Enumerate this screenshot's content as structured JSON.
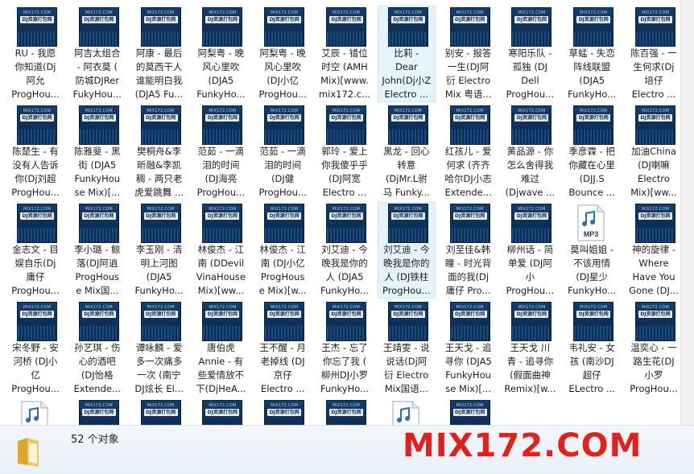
{
  "status": {
    "count_text": "52 个对象"
  },
  "watermark": "MIX172.COM",
  "thumb_site": "MIX172.COM",
  "thumb_brand": "DJ资源打包网",
  "files": [
    {
      "label": "RU - 我愿\n你知道(Dj\n阿允\nProgHou...",
      "icon": "thumb"
    },
    {
      "label": "阿吉太组合\n- 阿衣莫 (\n防城DJRer\nFukyHou...",
      "icon": "thumb"
    },
    {
      "label": "阿康 - 最后\n的莫西干人\n谁能明白我\n(DJA5 Fu...",
      "icon": "thumb"
    },
    {
      "label": "阿梨粤 - 晚\n风心里吹\n(DJA5\nFunkyHo...",
      "icon": "thumb"
    },
    {
      "label": "阿梨粤 - 晚\n风心里吹\n(DJ小亿\nProgHou...",
      "icon": "thumb"
    },
    {
      "label": "艾辰 - 错位\n时空 (AMH\nMix)[www.\nmix172.c...",
      "icon": "thumb"
    },
    {
      "label": "比莉 -\nDear\nJohn(Dj小Z\nElectro ...",
      "icon": "thumb",
      "selected": true
    },
    {
      "label": "别安 - 报答\n一生(DJ阿\n衍 Electro\nMix 粤语...",
      "icon": "thumb"
    },
    {
      "label": "寒阳乐队 -\n孤独 (DJ\nDell\nProgHou...",
      "icon": "thumb"
    },
    {
      "label": "草蜢 - 失恋\n阵线联盟\n(DJA5\nFunkyHo...",
      "icon": "thumb"
    },
    {
      "label": "陈百强 - 一\n生何求(Dj\n培仔\nElectro ...",
      "icon": "thumb"
    },
    {
      "label": "陈楚生 - 有\n没有人告诉\n你(Dj刘超\nProgHou...",
      "icon": "thumb"
    },
    {
      "label": "陈雅斐 - 黑\n街 (DJA5\nFunkyHou\nse Mix)[...",
      "icon": "thumb"
    },
    {
      "label": "樊桐舟&李\n昕融&李凯\n稠 - 两只老\n虎爱跳舞 ...",
      "icon": "thumb"
    },
    {
      "label": "范茹 - 一滴\n泪的时间\n(DJ海亮\nProgHou...",
      "icon": "thumb"
    },
    {
      "label": "范茹 - 一滴\n泪的时间\n(DJ健\nProgHou...",
      "icon": "thumb"
    },
    {
      "label": "郭玲 - 爱上\n你我傻乎乎\n(DJ阿宽\nElectro ...",
      "icon": "thumb"
    },
    {
      "label": "黑龙 - 回心\n转意\n(DjMr.L驸\n马 Funky...",
      "icon": "thumb"
    },
    {
      "label": "红孩儿 - 爱\n何求 (齐齐\n哈尔DJ小志\nExtende...",
      "icon": "thumb"
    },
    {
      "label": "黄品源 - 你\n怎么舍得我\n难过\n(Djwave ...",
      "icon": "thumb"
    },
    {
      "label": "季彦霖 - 把\n你藏在心里\n(DJJ.S\nBounce ...",
      "icon": "thumb"
    },
    {
      "label": "加油China\n(DJ喇嘛\nElectro\nMix)[ww...",
      "icon": "thumb"
    },
    {
      "label": "金志文 - 目\n娱自乐(Dj\n庸仔\nProgHou...",
      "icon": "thumb"
    },
    {
      "label": "李小璐 - 鲸\n落(DJ阿逍\nProgHous\ne Mix国...",
      "icon": "thumb"
    },
    {
      "label": "李玉刚 - 清\n明上河图\n(DJA5\nFunkyHo...",
      "icon": "thumb"
    },
    {
      "label": "林俊杰 - 江\n南 (DDevil\nVinaHouse\nMix)[ww...",
      "icon": "thumb"
    },
    {
      "label": "林俊杰 - 江\n南 (DJ小亿\nProgHous\ne Mix)[w...",
      "icon": "thumb"
    },
    {
      "label": "刘艾迪 - 今\n晚我是你的\n人 (DJA5\nFunkyHo...",
      "icon": "thumb"
    },
    {
      "label": "刘艾迪 - 今\n晚我是你的\n人 (DJ铁柱\nProgHou...",
      "icon": "thumb",
      "selected": true
    },
    {
      "label": "刘至佳&韩\n瞳 - 时光背\n面的我(Dj\n庸仔 Pro...",
      "icon": "thumb"
    },
    {
      "label": "柳州话 - 简\n单爱 (DJ阿\n小\nProgHou...",
      "icon": "thumb"
    },
    {
      "label": "莫叫姐姐 -\n不该用情\n(DJ星少\nFunkyHo...",
      "icon": "mp3"
    },
    {
      "label": "神的旋律 -\nWhere\nHave You\nGone (DJ...",
      "icon": "thumb"
    },
    {
      "label": "宋冬野 - 安\n河桥 (DJ小\n亿\nProgHou...",
      "icon": "thumb"
    },
    {
      "label": "孙艺琪 - 伤\n心的酒吧\n(DJ怡格\nExtende...",
      "icon": "thumb"
    },
    {
      "label": "谭咏麟 - 爱\n多一次痛多\n一次 (南宁\nDJ炫长 El...",
      "icon": "thumb"
    },
    {
      "label": "唐伯虎\nAnnie - 有\n些爱情放不\n下(DjHeA...",
      "icon": "thumb"
    },
    {
      "label": "王不醒 - 月\n老掉线 (DJ\n京仔\nElectro ...",
      "icon": "thumb"
    },
    {
      "label": "王杰 - 忘了\n你忘了我 (\n柳州DJ小罗\nFunkyHo...",
      "icon": "thumb"
    },
    {
      "label": "王靖雯 - 说\n说话(Dj阿\n衍 Electro\nMix国语...",
      "icon": "thumb"
    },
    {
      "label": "王天戈 - 追\n寻你 (DJA5\nFunkyHou\nse Mix)[...",
      "icon": "thumb"
    },
    {
      "label": "王天戈 川\n青 - 追寻你\n(假面曲神\nRemix)[w...",
      "icon": "thumb"
    },
    {
      "label": "韦礼安 - 女\n孩 (南沙DJ\n超仔\nELectro ...",
      "icon": "thumb"
    },
    {
      "label": "温奕心 - 一\n路生花(DJ\n小罗\nProgHou...",
      "icon": "thumb"
    },
    {
      "label": "",
      "icon": "mp3"
    },
    {
      "label": "",
      "icon": "thumb"
    },
    {
      "label": "",
      "icon": "thumb"
    },
    {
      "label": "",
      "icon": "thumb"
    },
    {
      "label": "",
      "icon": "thumb"
    },
    {
      "label": "",
      "icon": "thumb"
    },
    {
      "label": "",
      "icon": "mp3"
    },
    {
      "label": "",
      "icon": "thumb"
    }
  ],
  "mp3_badge": "MP3"
}
